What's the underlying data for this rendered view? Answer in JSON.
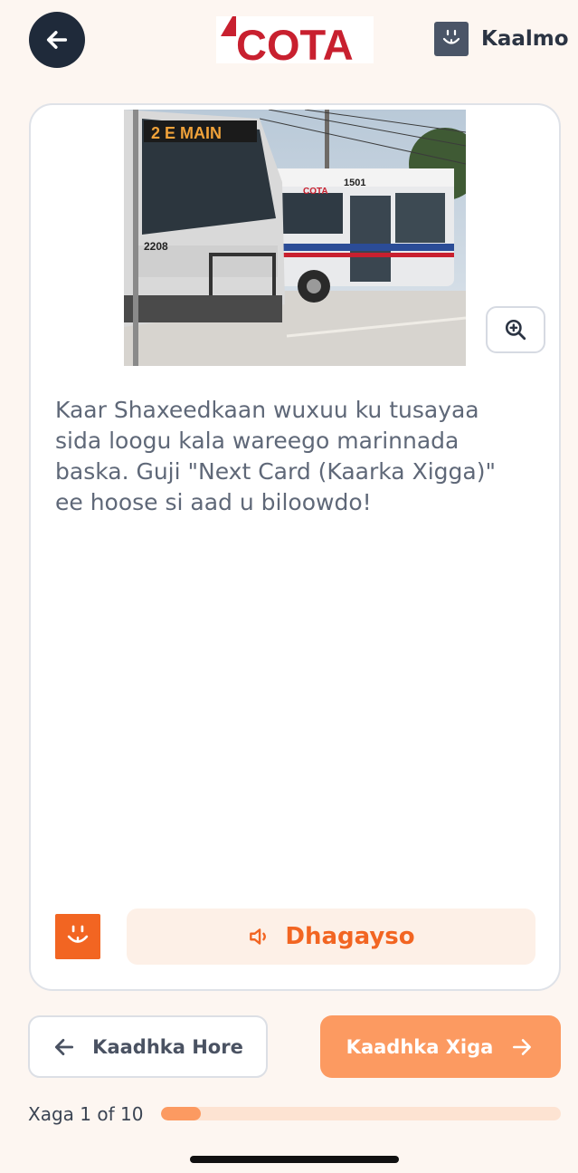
{
  "header": {
    "back_icon": "arrow-left-icon",
    "logo_text": "COTA",
    "help_icon": "owl-face-icon",
    "help_label": "Kaalmo"
  },
  "card": {
    "image_alt": "COTA buses at a bus stop",
    "bus_numbers": [
      "2208",
      "1501"
    ],
    "bus_route_sign": "2 E MAIN",
    "zoom_icon": "zoom-in-icon",
    "text": "Kaar Shaxeedkaan wuxuu ku tusayaa sida loogu kala wareego marinnada baska. Guji \"Next Card (Kaarka Xigga)\" ee hoose si aad u biloowdo!",
    "listen_icon": "speaker-icon",
    "listen_label": "Dhagayso",
    "owl_icon": "owl-face-icon"
  },
  "nav": {
    "prev_label": "Kaadhka Hore",
    "next_label": "Kaadhka Xiga"
  },
  "progress": {
    "label": "Xaga 1 of 10",
    "current": 1,
    "total": 10
  },
  "colors": {
    "accent": "#f26522",
    "button": "#fc9a61",
    "background": "#fdf6f1",
    "dark": "#1f2a3a"
  }
}
